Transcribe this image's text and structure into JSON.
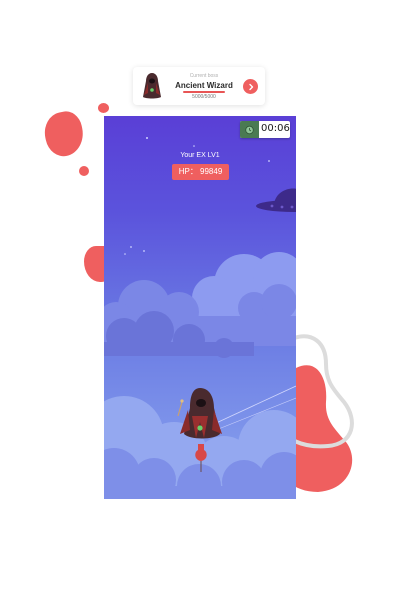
{
  "boss_card": {
    "subtitle": "Current boss",
    "name": "Ancient Wizard",
    "hp_text": "5000/5000",
    "hp_fraction": 1.0,
    "go_icon": "chevron-right-icon"
  },
  "game": {
    "timer": {
      "text": "00:06",
      "icon": "alarm-clock-icon"
    },
    "player_label": "Your EX  LV1",
    "hp_text": "HP：  99849"
  },
  "colors": {
    "accent_red": "#ef5f5f",
    "sky_top": "#5a3fd6",
    "sky_bottom": "#8aa5ef",
    "timer_green": "#4a7a52"
  }
}
